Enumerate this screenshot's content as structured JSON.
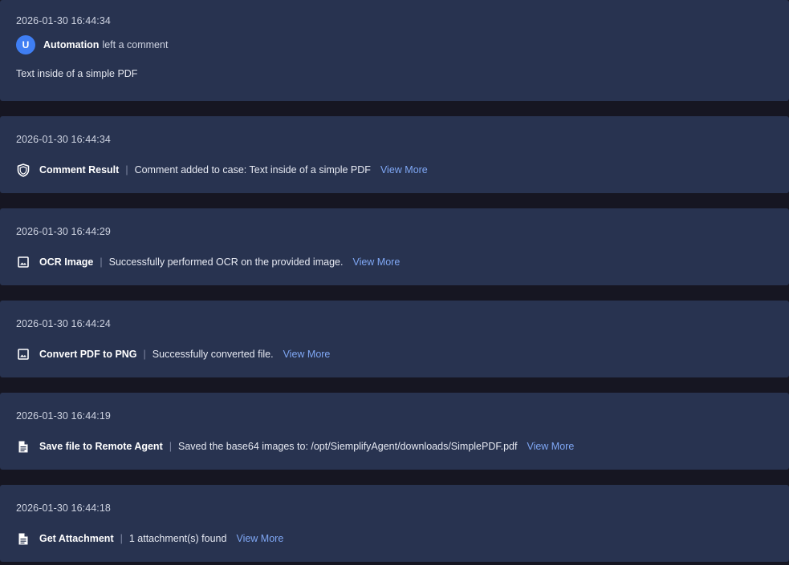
{
  "comment": {
    "timestamp": "2026-01-30 16:44:34",
    "avatar_letter": "U",
    "author": "Automation",
    "action_text": "left a comment",
    "body": "Text inside of a simple PDF"
  },
  "actions": [
    {
      "timestamp": "2026-01-30 16:44:34",
      "icon": "shield-icon",
      "name": "Comment Result",
      "separator": "|",
      "message": "Comment added to case: Text inside of a simple PDF",
      "link": "View More"
    },
    {
      "timestamp": "2026-01-30 16:44:29",
      "icon": "image-icon",
      "name": "OCR Image",
      "separator": "|",
      "message": "Successfully performed OCR on the provided image.",
      "link": "View More"
    },
    {
      "timestamp": "2026-01-30 16:44:24",
      "icon": "image-icon",
      "name": "Convert PDF to PNG",
      "separator": "|",
      "message": "Successfully converted file.",
      "link": "View More"
    },
    {
      "timestamp": "2026-01-30 16:44:19",
      "icon": "document-icon",
      "name": "Save file to Remote Agent",
      "separator": "|",
      "message": "Saved the base64 images to: /opt/SiemplifyAgent/downloads/SimplePDF.pdf",
      "link": "View More"
    },
    {
      "timestamp": "2026-01-30 16:44:18",
      "icon": "document-icon",
      "name": "Get Attachment",
      "separator": "|",
      "message": "1 attachment(s) found",
      "link": "View More"
    }
  ],
  "colors": {
    "background": "#161622",
    "card": "#283350",
    "accent_link": "#7fa7f4",
    "avatar": "#3f7ef3"
  }
}
